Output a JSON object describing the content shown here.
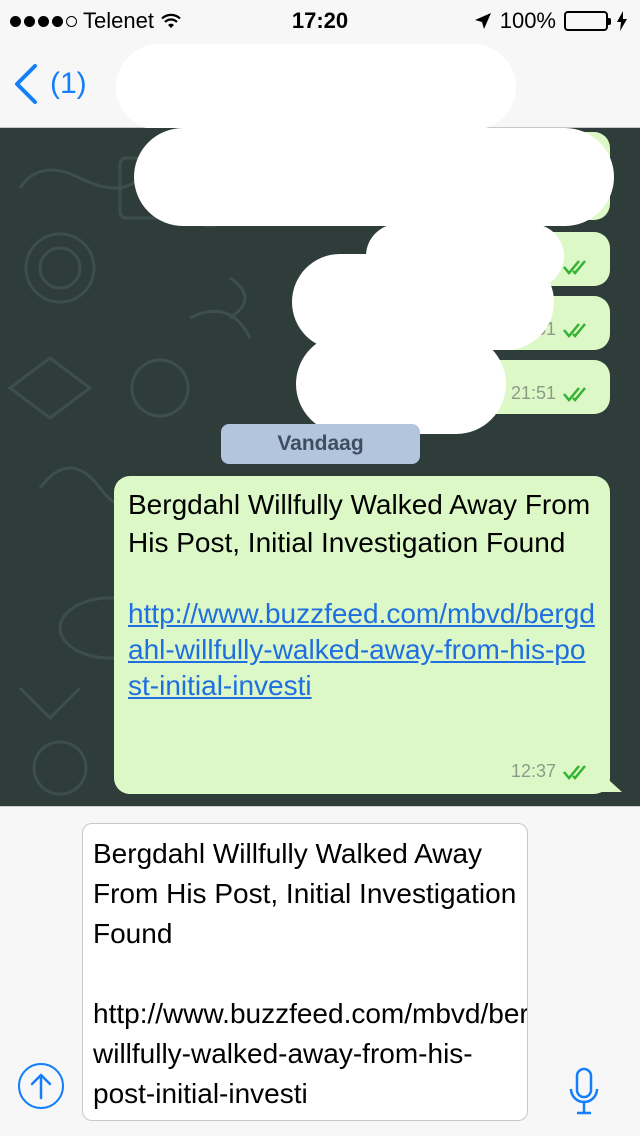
{
  "status_bar": {
    "carrier": "Telenet",
    "time": "17:20",
    "battery_percent": "100%",
    "signal_bars_filled": 4,
    "signal_bars_total": 5
  },
  "nav": {
    "back_label": "(1)"
  },
  "chat": {
    "background_color": "#2f3d3a",
    "bubble_color": "#dcf8c6",
    "earlier_messages": [
      {
        "time": ""
      },
      {
        "time": ""
      },
      {
        "time": "21:51"
      },
      {
        "time": "21:51"
      }
    ],
    "date_separator": "Vandaag",
    "message": {
      "title": "Bergdahl Willfully Walked Away From His Post, Initial Investigation Found",
      "link": "http://www.buzzfeed.com/mbvd/bergdahl-willfully-walked-away-from-his-post-initial-investi",
      "time": "12:37",
      "status": "read"
    }
  },
  "input": {
    "text": "Bergdahl Willfully Walked Away From His Post, Initial Investigation Found\n\nhttp://www.buzzfeed.com/mbvd/bergdahl-willfully-walked-away-from-his-post-initial-investi",
    "accent_color": "#147efb"
  }
}
